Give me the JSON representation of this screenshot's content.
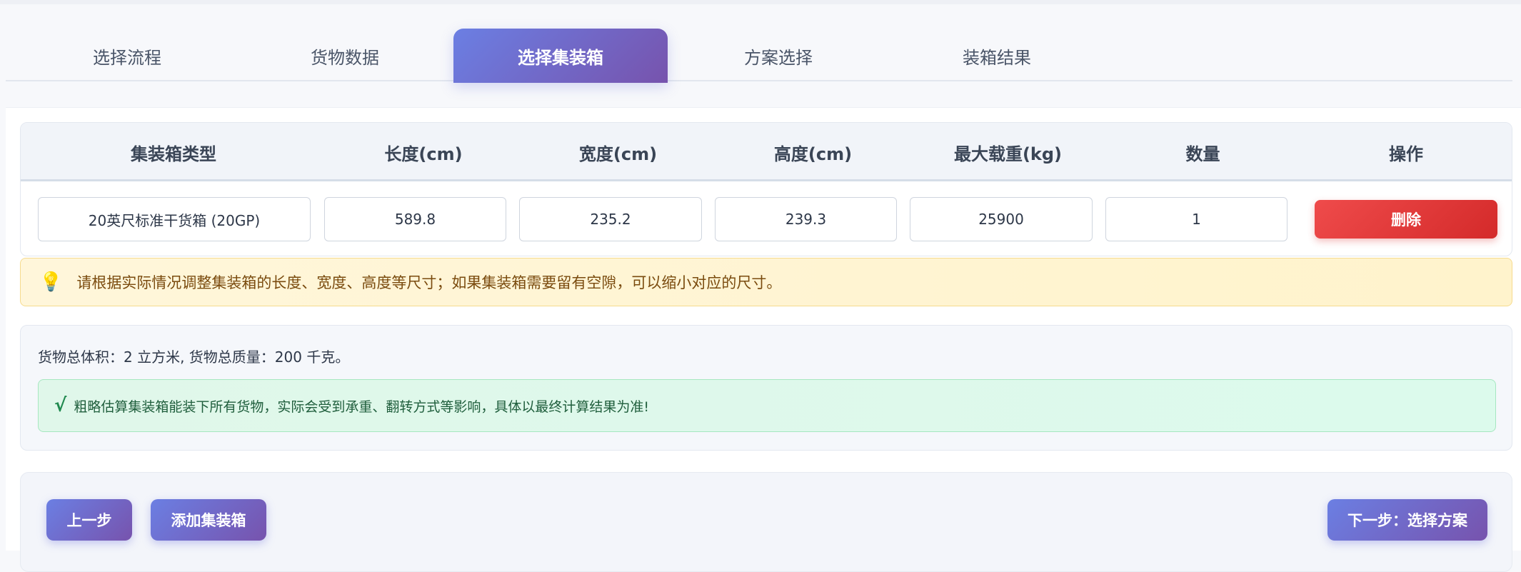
{
  "tabs": [
    {
      "label": "选择流程"
    },
    {
      "label": "货物数据"
    },
    {
      "label": "选择集装箱",
      "active": true
    },
    {
      "label": "方案选择"
    },
    {
      "label": "装箱结果"
    }
  ],
  "table": {
    "headers": [
      "集装箱类型",
      "长度(cm)",
      "宽度(cm)",
      "高度(cm)",
      "最大载重(kg)",
      "数量",
      "操作"
    ],
    "rows": [
      {
        "type": "20英尺标准干货箱 (20GP)",
        "length": "589.8",
        "width": "235.2",
        "height": "239.3",
        "max_load": "25900",
        "quantity": "1",
        "action_label": "删除"
      }
    ]
  },
  "tip": {
    "icon": "lightbulb-icon",
    "text": "请根据实际情况调整集装箱的长度、宽度、高度等尺寸；如果集装箱需要留有空隙，可以缩小对应的尺寸。"
  },
  "summary": {
    "text": "货物总体积：2 立方米, 货物总质量：200 千克。",
    "status_icon": "check-icon",
    "status_text": "粗略估算集装箱能装下所有货物，实际会受到承重、翻转方式等影响，具体以最终计算结果为准!"
  },
  "buttons": {
    "prev": "上一步",
    "add": "添加集装箱",
    "next": "下一步：选择方案"
  },
  "colors": {
    "accent_start": "#6b7fe3",
    "accent_end": "#7753ad",
    "danger": "#e23a3a",
    "tip_bg": "#fff6da",
    "success_bg": "#e0f7ea"
  }
}
